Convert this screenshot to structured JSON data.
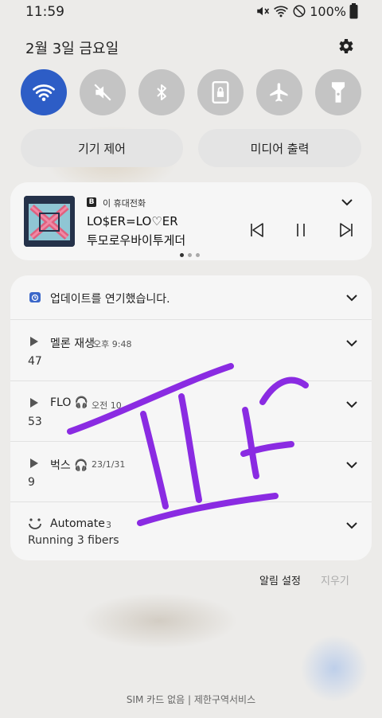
{
  "status_bar": {
    "time": "11:59",
    "battery": "100%"
  },
  "header": {
    "date": "2월 3일 금요일"
  },
  "controls": {
    "device_control": "기기 제어",
    "media_output": "미디어 출력"
  },
  "media": {
    "source_badge": "B",
    "source": "이 휴대전화",
    "song": "LO$ER=LO♡ER",
    "artist": "투모로우바이투게더"
  },
  "notifications": [
    {
      "icon": "calendar-icon",
      "title": "업데이트를 연기했습니다.",
      "time": "",
      "count": ""
    },
    {
      "icon": "play-icon",
      "title": "멜론 재생",
      "time": "오후 9:48",
      "count": "47"
    },
    {
      "icon": "play-icon",
      "title": "FLO 🎧",
      "time": "오전 10",
      "count": "53"
    },
    {
      "icon": "play-icon",
      "title": "벅스 🎧",
      "time": "23/1/31",
      "count": "9"
    },
    {
      "icon": "automate-icon",
      "title": "Automate",
      "time": "3",
      "count": "Running 3 fibers"
    }
  ],
  "actions": {
    "settings": "알림 설정",
    "clear": "지우기"
  },
  "footer": {
    "carrier": "SIM 카드 없음 | 제한구역서비스"
  },
  "colors": {
    "accent": "#2d5dc6",
    "scribble": "#8a2be2"
  }
}
